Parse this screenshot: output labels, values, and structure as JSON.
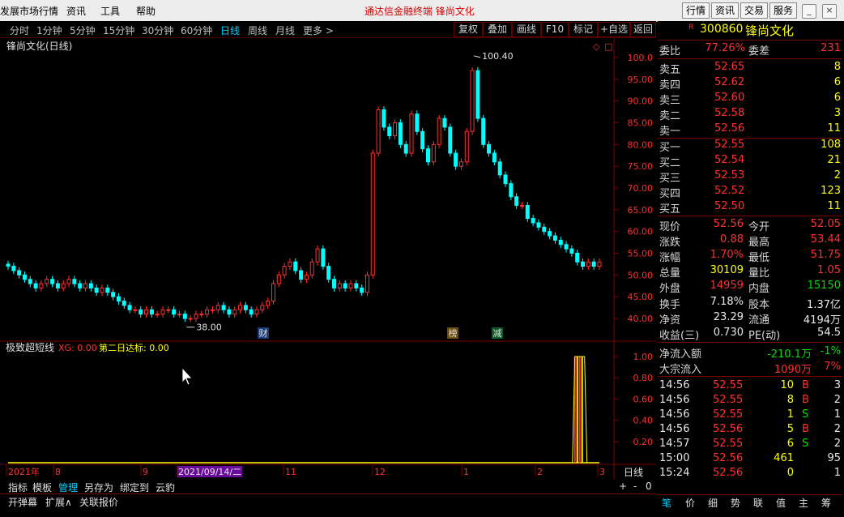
{
  "menu": {
    "items": [
      "发展市场行情",
      "资讯",
      "工具",
      "帮助"
    ],
    "title": "通达信金融终端   锋尚文化",
    "right_buttons": [
      "行情",
      "资讯",
      "交易",
      "服务"
    ]
  },
  "period": {
    "items": [
      "分时",
      "1分钟",
      "5分钟",
      "15分钟",
      "30分钟",
      "60分钟",
      "日线",
      "周线",
      "月线",
      "更多 >"
    ],
    "active": "日线",
    "tools": [
      "复权",
      "叠加",
      "画线",
      "F10",
      "标记",
      "+自选",
      "返回"
    ]
  },
  "chart": {
    "title": "锋尚文化(日线)",
    "price_axis": [
      "100.0",
      "95.00",
      "90.00",
      "85.00",
      "80.00",
      "75.00",
      "70.00",
      "65.00",
      "60.00",
      "55.00",
      "50.00",
      "45.00",
      "40.00"
    ],
    "high_label": "100.40",
    "low_label": "38.00",
    "markers": [
      {
        "text": "财"
      },
      {
        "text": "榜"
      },
      {
        "text": "减"
      }
    ],
    "indicator_title": "极致超短线",
    "indicator_xg": "XG: 0.00",
    "indicator_d2": "第二日达标: 0.00",
    "indicator_axis": [
      "1.00",
      "0.80",
      "0.60",
      "0.40",
      "0.20"
    ],
    "date_labels": [
      "2021年",
      "8",
      "9",
      "2021/09/14/二",
      "11",
      "12",
      "1",
      "2",
      "3"
    ],
    "period_label": "日线"
  },
  "chart_data": {
    "type": "candlestick",
    "title": "锋尚文化(日线)",
    "ylim": [
      38,
      101
    ],
    "high": 100.4,
    "low": 38.0,
    "close_series": [
      52,
      51,
      50,
      49,
      48,
      47,
      48,
      49,
      48,
      47,
      48,
      49,
      48,
      47,
      48,
      47,
      46,
      47,
      46,
      45,
      44,
      43,
      42,
      42,
      41,
      42,
      41,
      41,
      42,
      42,
      41,
      41,
      40,
      40,
      41,
      41,
      42,
      42,
      43,
      42,
      41,
      42,
      43,
      42,
      41,
      42,
      43,
      44,
      48,
      50,
      52,
      53,
      51,
      49,
      50,
      53,
      56,
      52,
      49,
      47,
      48,
      47,
      48,
      47,
      46,
      50,
      78,
      88,
      84,
      82,
      85,
      80,
      78,
      87,
      83,
      79,
      76,
      80,
      86,
      84,
      78,
      75,
      76,
      83,
      97,
      86,
      80,
      78,
      76,
      73,
      71,
      68,
      66,
      66,
      63,
      62,
      61,
      60,
      59,
      58,
      57,
      56,
      55,
      53,
      52,
      53,
      52,
      53
    ]
  },
  "quote": {
    "code": "300860",
    "name": "锋尚文化",
    "weibi_label": "委比",
    "weibi": "77.26%",
    "weicha_label": "委差",
    "weicha": "231",
    "asks": [
      {
        "l": "卖五",
        "p": "52.65",
        "v": "8"
      },
      {
        "l": "卖四",
        "p": "52.62",
        "v": "6"
      },
      {
        "l": "卖三",
        "p": "52.60",
        "v": "6"
      },
      {
        "l": "卖二",
        "p": "52.58",
        "v": "3"
      },
      {
        "l": "卖一",
        "p": "52.56",
        "v": "11"
      }
    ],
    "bids": [
      {
        "l": "买一",
        "p": "52.55",
        "v": "108"
      },
      {
        "l": "买二",
        "p": "52.54",
        "v": "21"
      },
      {
        "l": "买三",
        "p": "52.53",
        "v": "2"
      },
      {
        "l": "买四",
        "p": "52.52",
        "v": "123"
      },
      {
        "l": "买五",
        "p": "52.50",
        "v": "11"
      }
    ],
    "stats": [
      {
        "l": "现价",
        "v": "52.56",
        "l2": "今开",
        "v2": "52.05"
      },
      {
        "l": "涨跌",
        "v": "0.88",
        "l2": "最高",
        "v2": "53.44"
      },
      {
        "l": "涨幅",
        "v": "1.70%",
        "l2": "最低",
        "v2": "51.75"
      },
      {
        "l": "总量",
        "v": "30109",
        "l2": "量比",
        "v2": "1.05"
      },
      {
        "l": "外盘",
        "v": "14959",
        "l2": "内盘",
        "v2": "15150"
      },
      {
        "l": "换手",
        "v": "7.18%",
        "l2": "股本",
        "v2": "1.37亿"
      },
      {
        "l": "净资",
        "v": "23.29",
        "l2": "流通",
        "v2": "4194万"
      },
      {
        "l": "收益(三)",
        "v": "0.730",
        "l2": "PE(动)",
        "v2": "54.5"
      }
    ],
    "flow": [
      {
        "l": "净流入额",
        "v": "-210.1万",
        "p": "-1%"
      },
      {
        "l": "大宗流入",
        "v": "1090万",
        "p": "7%"
      }
    ],
    "ticks": [
      {
        "t": "14:56",
        "p": "52.55",
        "v": "10",
        "s": "B",
        "n": "3"
      },
      {
        "t": "14:56",
        "p": "52.55",
        "v": "8",
        "s": "B",
        "n": "2"
      },
      {
        "t": "14:56",
        "p": "52.55",
        "v": "1",
        "s": "S",
        "n": "1"
      },
      {
        "t": "14:56",
        "p": "52.56",
        "v": "5",
        "s": "B",
        "n": "2"
      },
      {
        "t": "14:57",
        "p": "52.55",
        "v": "6",
        "s": "S",
        "n": "2"
      },
      {
        "t": "15:00",
        "p": "52.56",
        "v": "461",
        "s": "",
        "n": "95"
      },
      {
        "t": "15:24",
        "p": "52.56",
        "v": "0",
        "s": "",
        "n": "1"
      }
    ],
    "tabs": [
      "笔",
      "价",
      "细",
      "势",
      "联",
      "值",
      "主",
      "筹"
    ]
  },
  "bottom": {
    "tabs1": [
      "指标",
      "模板",
      "管理",
      "另存为",
      "绑定到",
      "云豹"
    ],
    "tabs2": [
      "开弹幕",
      "扩展∧",
      "关联报价"
    ],
    "controls": [
      "+",
      "-",
      "0"
    ]
  },
  "colors": {
    "up": "#ff3030",
    "down": "#00ffff",
    "accent": "#ffff00"
  }
}
